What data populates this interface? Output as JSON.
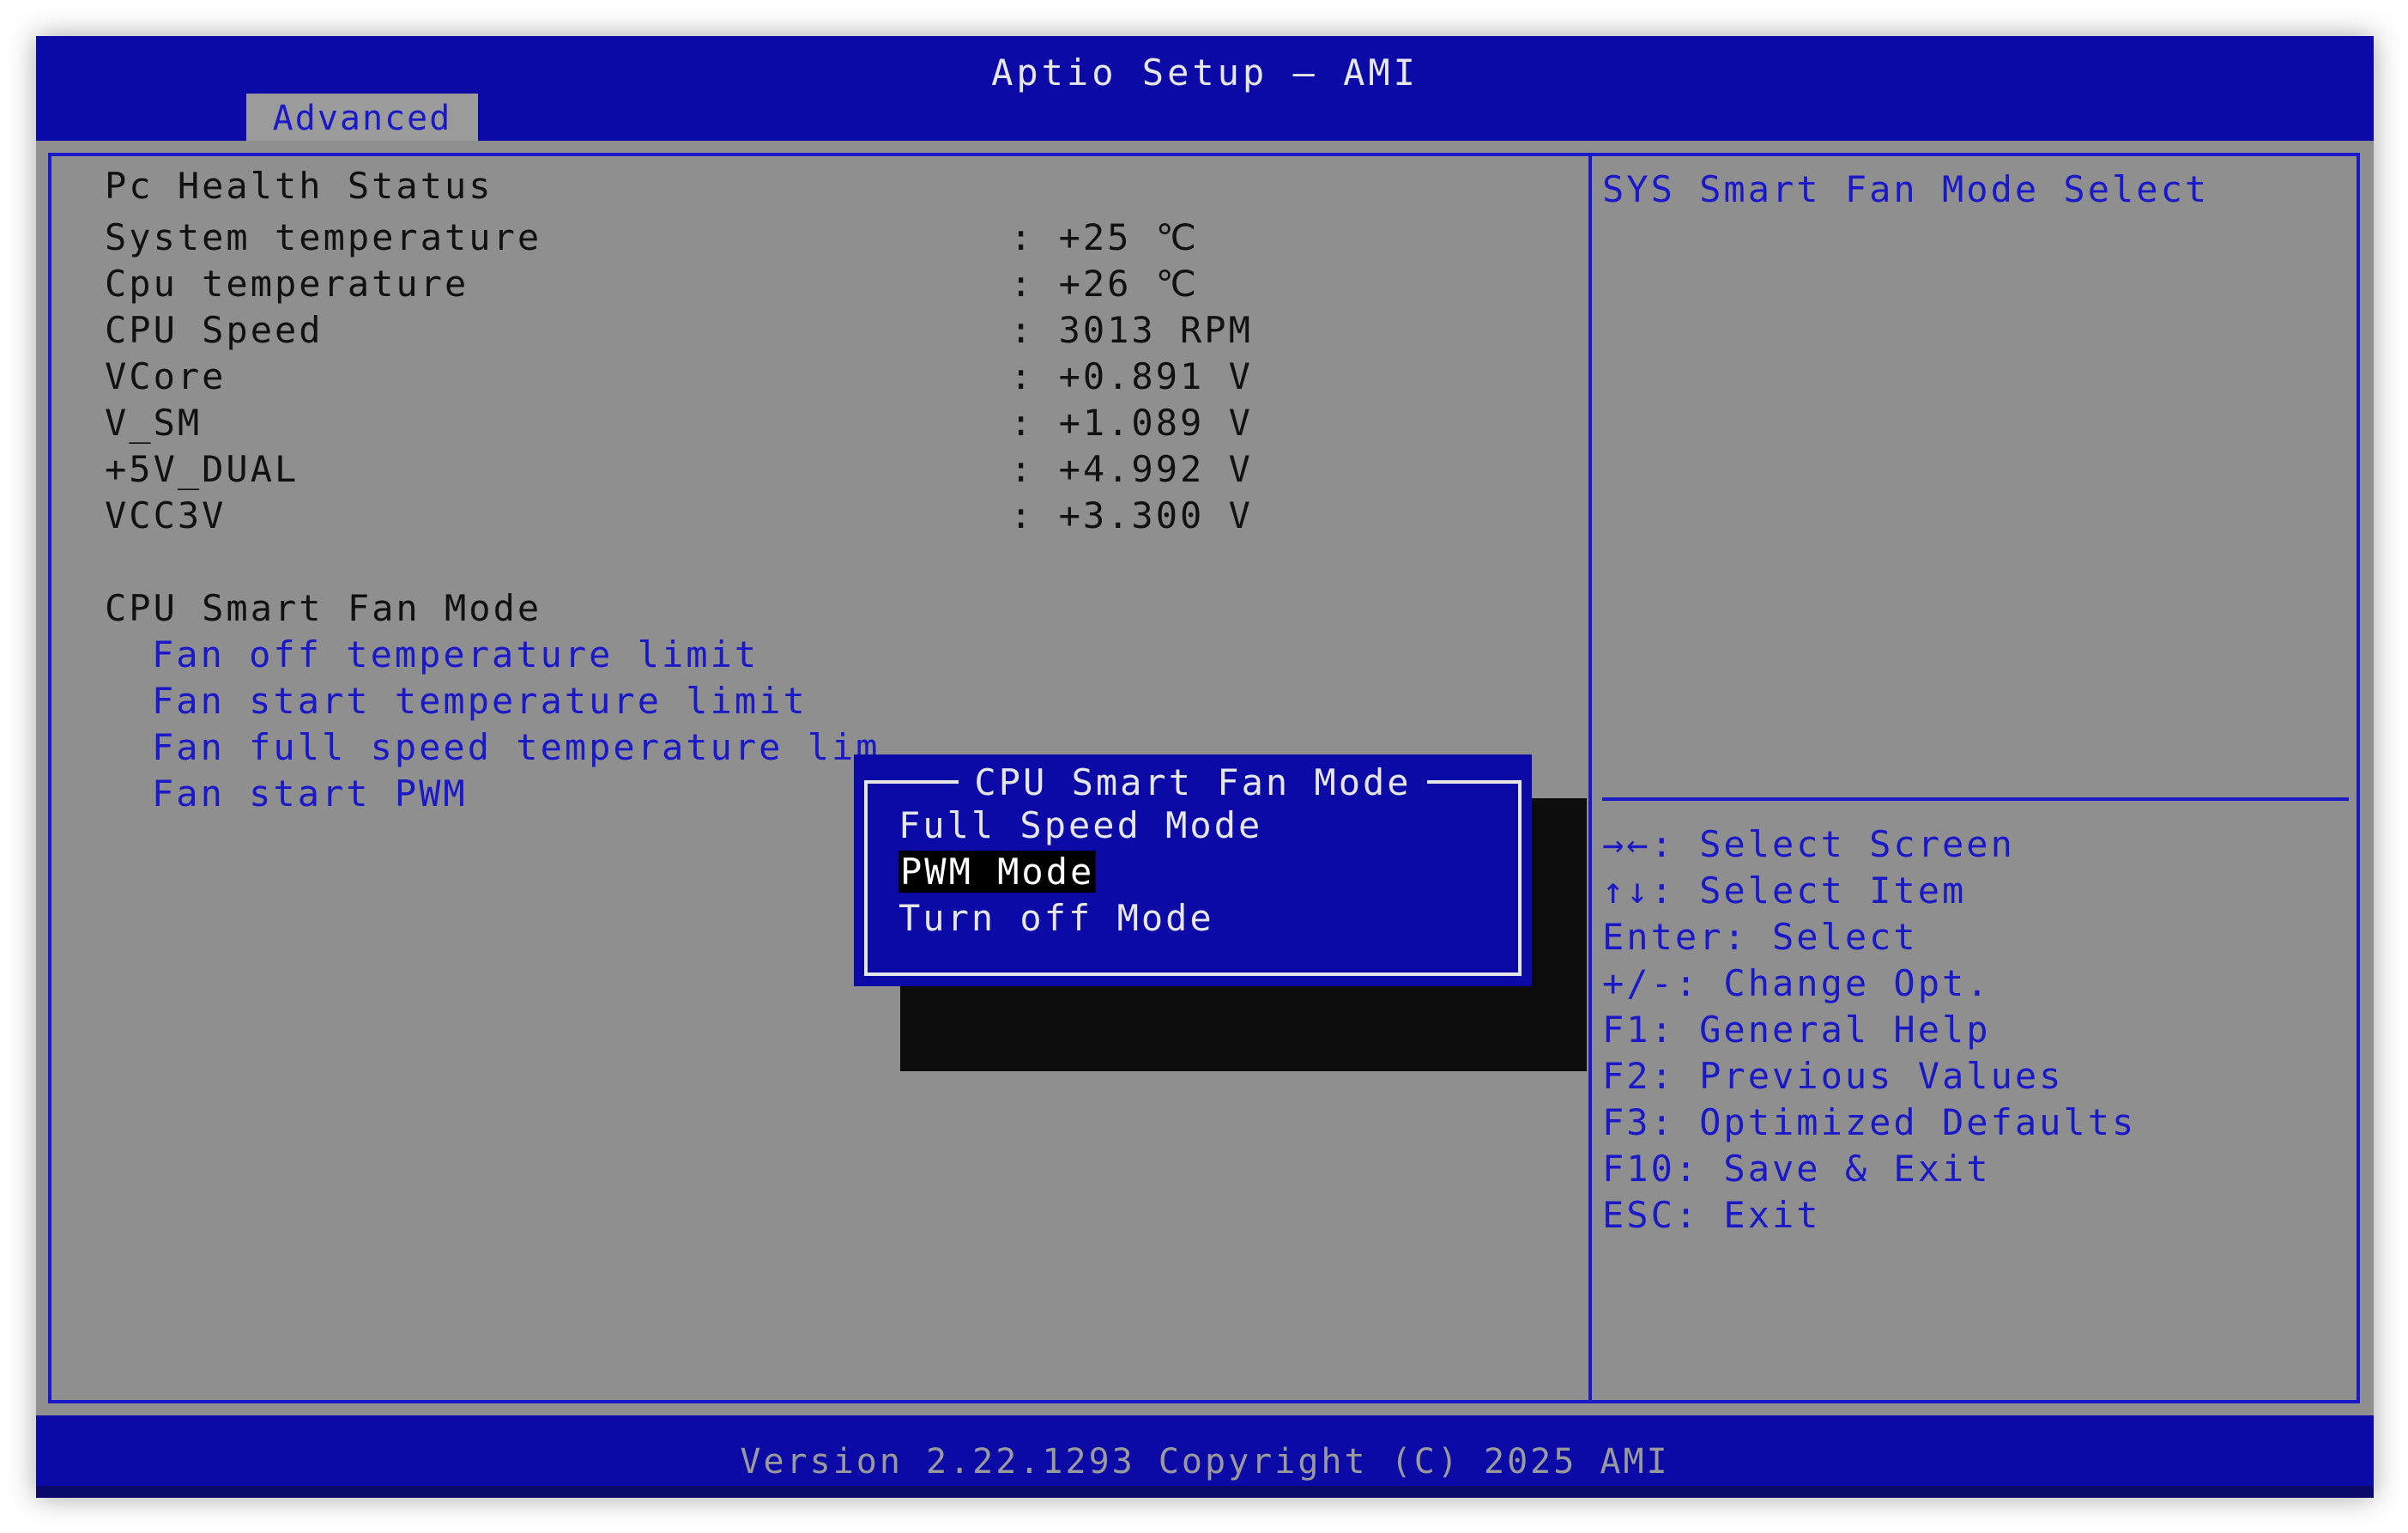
{
  "header": {
    "title": "Aptio Setup – AMI",
    "tabs": [
      {
        "label": "Advanced"
      }
    ]
  },
  "main": {
    "section_title": "Pc Health Status",
    "readings": [
      {
        "label": "System temperature",
        "value": ": +25 ℃"
      },
      {
        "label": "Cpu temperature",
        "value": ": +26 ℃"
      },
      {
        "label": "CPU Speed",
        "value": ": 3013 RPM"
      },
      {
        "label": "VCore",
        "value": ": +0.891 V"
      },
      {
        "label": "V_SM",
        "value": ": +1.089 V"
      },
      {
        "label": "+5V_DUAL",
        "value": ": +4.992 V"
      },
      {
        "label": "VCC3V",
        "value": ": +3.300 V"
      }
    ],
    "fan_mode_label": "CPU Smart Fan Mode",
    "submenu": [
      {
        "label": "Fan off temperature limit"
      },
      {
        "label": "Fan start temperature limit"
      },
      {
        "label": "Fan full speed temperature lim"
      },
      {
        "label": "Fan start PWM"
      }
    ]
  },
  "popup": {
    "title": "CPU Smart Fan Mode",
    "options": [
      {
        "label": "Full Speed Mode",
        "selected": false
      },
      {
        "label": "PWM Mode",
        "selected": true
      },
      {
        "label": "Turn off Mode",
        "selected": false
      }
    ]
  },
  "help": {
    "description": "SYS Smart Fan Mode Select",
    "keys": [
      {
        "text": "→←: Select Screen"
      },
      {
        "text": "↑↓: Select Item"
      },
      {
        "text": "Enter: Select"
      },
      {
        "text": "+/-: Change Opt."
      },
      {
        "text": "F1: General Help"
      },
      {
        "text": "F2: Previous Values"
      },
      {
        "text": "F3: Optimized Defaults"
      },
      {
        "text": "F10: Save & Exit"
      },
      {
        "text": "ESC: Exit"
      }
    ]
  },
  "footer": {
    "text": "Version 2.22.1293 Copyright (C) 2025 AMI"
  },
  "colors": {
    "bios_blue": "#0b0aa6",
    "panel_gray": "#8f8f8f",
    "accent_blue_text": "#1a19c8",
    "popup_border": "#e6e6e6"
  }
}
